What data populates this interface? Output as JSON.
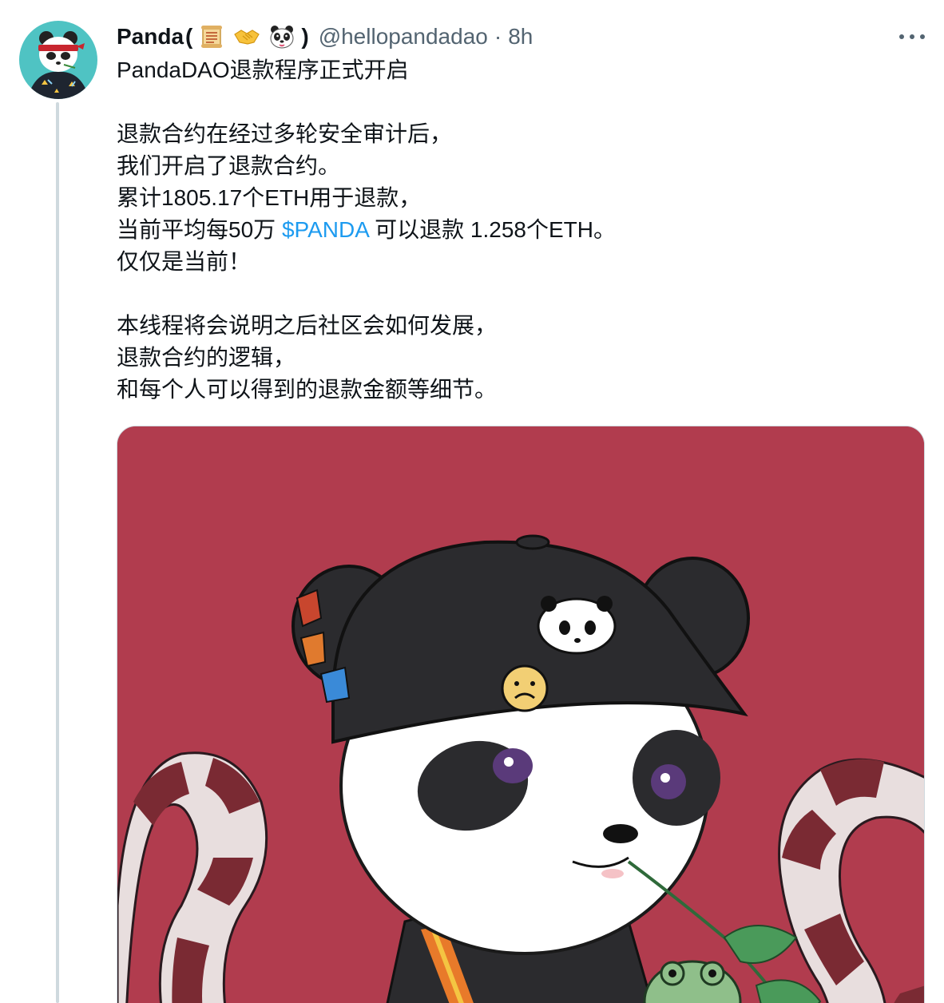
{
  "author": {
    "display_name": "Panda",
    "open_paren": "(",
    "close_paren": ")",
    "badges": [
      "scroll-emoji",
      "handshake-emoji",
      "panda-emoji"
    ],
    "handle": "@hellopandadao",
    "separator": "·",
    "time": "8h"
  },
  "tweet": {
    "lines": [
      "PandaDAO退款程序正式开启",
      "",
      "退款合约在经过多轮安全审计后，",
      "我们开启了退款合约。",
      "累计1805.17个ETH用于退款，",
      {
        "before": "当前平均每50万 ",
        "cashtag": "$PANDA",
        "after": " 可以退款 1.258个ETH。"
      },
      "仅仅是当前！",
      "",
      "本线程将会说明之后社区会如何发展，",
      "退款合约的逻辑，",
      "和每个人可以得到的退款金额等细节。"
    ]
  },
  "colors": {
    "text": "#0f1419",
    "secondary": "#536471",
    "link": "#1d9bf0",
    "media_bg": "#b13c4e",
    "thread_line": "#cfd9de"
  },
  "icons": {
    "more": "more-horizontal-icon"
  }
}
